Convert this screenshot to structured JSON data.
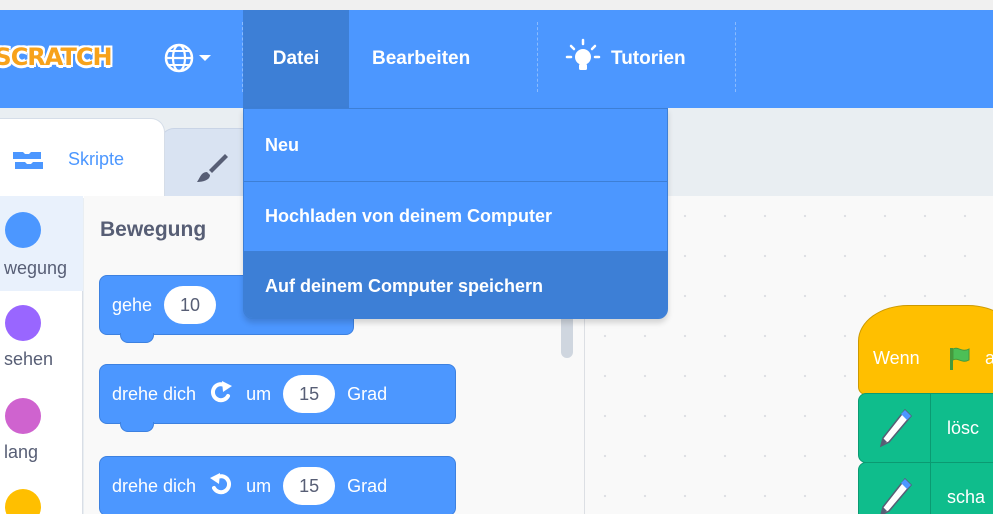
{
  "menubar": {
    "logo_text": "SCRATCH",
    "language_icon": "globe-icon",
    "menu": {
      "file": "Datei",
      "edit": "Bearbeiten",
      "tutorials": "Tutorien"
    }
  },
  "file_menu": {
    "items": [
      {
        "label": "Neu"
      },
      {
        "label": "Hochladen von deinem Computer"
      },
      {
        "label": "Auf deinem Computer speichern"
      }
    ]
  },
  "tabs": {
    "scripts": "Skripte",
    "costumes_icon": "brush-icon"
  },
  "categories": [
    {
      "label": "wegung",
      "color": "#4c97ff"
    },
    {
      "label": "sehen",
      "color": "#9966ff"
    },
    {
      "label": "lang",
      "color": "#cf63cf"
    },
    {
      "label": "",
      "color": "#ffbf00"
    }
  ],
  "palette": {
    "title": "Bewegung",
    "blocks": [
      {
        "prefix": "gehe",
        "value": "10"
      },
      {
        "prefix": "drehe dich",
        "icon": "rotate-right-icon",
        "mid": "um",
        "value": "15",
        "suffix": "Grad"
      },
      {
        "prefix": "drehe dich",
        "icon": "rotate-left-icon",
        "mid": "um",
        "value": "15",
        "suffix": "Grad"
      }
    ]
  },
  "code": {
    "hat_text": "Wenn",
    "hat_suffix": "a",
    "pen_blocks": [
      {
        "text": "lösc"
      },
      {
        "text": "scha"
      }
    ]
  },
  "colors": {
    "menubar": "#4c97ff",
    "menu_active": "#3d7fd6",
    "motion": "#4c97ff",
    "events": "#ffbf00",
    "pen": "#0fbd8c"
  }
}
